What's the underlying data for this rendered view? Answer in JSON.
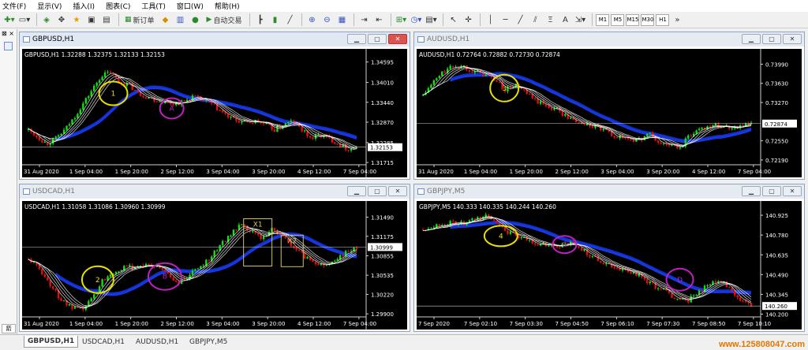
{
  "menu": [
    "文件(F)",
    "显示(V)",
    "插入(I)",
    "图表(C)",
    "工具(T)",
    "窗口(W)",
    "帮助(H)"
  ],
  "toolbar": {
    "new_order": "新订单",
    "auto_trading": "自动交易",
    "timeframes": [
      "M1",
      "M5",
      "M15",
      "M30",
      "H1"
    ]
  },
  "windows": [
    {
      "title": "GBPUSD,H1",
      "symbol_line": "GBPUSD,H1  1.32288 1.32375 1.32133 1.32153",
      "prices": [
        "1.34595",
        "1.34010",
        "1.33440",
        "1.32870",
        "1.32285",
        "1.32153",
        "1.31715"
      ],
      "current": "1.32153",
      "dates": [
        "31 Aug 2020",
        "1 Sep 04:00",
        "1 Sep 20:00",
        "2 Sep 12:00",
        "3 Sep 04:00",
        "3 Sep 20:00",
        "4 Sep 12:00",
        "7 Sep 04:00"
      ],
      "marks": [
        {
          "label": "1",
          "color": "#e8e000"
        },
        {
          "label": "A",
          "color": "#c020c0"
        }
      ],
      "series": [
        1.3265,
        1.3245,
        1.3225,
        1.324,
        1.3265,
        1.33,
        1.334,
        1.338,
        1.342,
        1.343,
        1.34,
        1.3395,
        1.337,
        1.336,
        1.335,
        1.3345,
        1.334,
        1.3345,
        1.336,
        1.335,
        1.334,
        1.332,
        1.33,
        1.329,
        1.3285,
        1.329,
        1.328,
        1.3265,
        1.328,
        1.329,
        1.3265,
        1.324,
        1.325,
        1.324,
        1.3225,
        1.321,
        1.3215
      ],
      "ylim": [
        1.3165,
        1.347
      ]
    },
    {
      "title": "AUDUSD,H1",
      "symbol_line": "AUDUSD,H1  0.72764 0.72882 0.72730 0.72874",
      "prices": [
        "0.73990",
        "0.73630",
        "0.73270",
        "0.72874",
        "0.72550",
        "0.72190"
      ],
      "current": "0.72874",
      "dates": [
        "31 Aug 2020",
        "1 Sep 04:00",
        "1 Sep 20:00",
        "2 Sep 12:00",
        "3 Sep 04:00",
        "3 Sep 20:00",
        "4 Sep 12:00",
        "7 Sep 04:00"
      ],
      "marks": [
        {
          "label": "3",
          "color": "#e8e000"
        }
      ],
      "series": [
        0.734,
        0.7365,
        0.7385,
        0.7395,
        0.7395,
        0.7385,
        0.738,
        0.737,
        0.735,
        0.736,
        0.7345,
        0.733,
        0.732,
        0.7315,
        0.73,
        0.729,
        0.7285,
        0.728,
        0.727,
        0.7262,
        0.726,
        0.7255,
        0.727,
        0.725,
        0.7248,
        0.724,
        0.7265,
        0.7278,
        0.7285,
        0.7284,
        0.728,
        0.7284,
        0.7287
      ],
      "ylim": [
        0.721,
        0.741
      ]
    },
    {
      "title": "USDCAD,H1",
      "symbol_line": "USDCAD,H1  1.31058 1.31086 1.30960 1.30999",
      "prices": [
        "1.31490",
        "1.31175",
        "1.30999",
        "1.30855",
        "1.30535",
        "1.30220",
        "1.29900"
      ],
      "current": "1.30999",
      "dates": [
        "31 Aug 2020",
        "1 Sep 04:00",
        "1 Sep 20:00",
        "2 Sep 12:00",
        "3 Sep 04:00",
        "3 Sep 20:00",
        "4 Sep 12:00",
        "7 Sep 04:00"
      ],
      "marks": [
        {
          "label": "2",
          "color": "#e8e000"
        },
        {
          "label": "B",
          "color": "#c020c0"
        },
        {
          "label": "X1",
          "color": "#d8c060"
        },
        {
          "label": "X2",
          "color": "#d8c060"
        }
      ],
      "series": [
        1.308,
        1.3065,
        1.304,
        1.3015,
        1.3,
        1.2995,
        1.3015,
        1.3045,
        1.306,
        1.3065,
        1.3068,
        1.307,
        1.3068,
        1.306,
        1.304,
        1.305,
        1.3065,
        1.308,
        1.31,
        1.312,
        1.3135,
        1.3125,
        1.3115,
        1.313,
        1.3118,
        1.31,
        1.3085,
        1.3075,
        1.307,
        1.308,
        1.309,
        1.31
      ],
      "ylim": [
        1.2985,
        1.316
      ]
    },
    {
      "title": "GBPJPY,M5",
      "symbol_line": "GBPJPY,M5  140.333 140.335 140.244 140.260",
      "prices": [
        "140.925",
        "140.780",
        "140.635",
        "140.490",
        "140.345",
        "140.260",
        "140.200"
      ],
      "current": "140.260",
      "dates": [
        "7 Sep 2020",
        "7 Sep 02:10",
        "7 Sep 03:30",
        "7 Sep 04:50",
        "7 Sep 06:10",
        "7 Sep 07:30",
        "7 Sep 08:50",
        "7 Sep 10:10"
      ],
      "marks": [
        {
          "label": "4",
          "color": "#e8e000"
        },
        {
          "label": "C",
          "color": "#c020c0"
        },
        {
          "label": "D",
          "color": "#c020c0"
        }
      ],
      "series": [
        140.82,
        140.85,
        140.86,
        140.87,
        140.86,
        140.9,
        140.92,
        140.88,
        140.8,
        140.76,
        140.74,
        140.71,
        140.7,
        140.7,
        140.72,
        140.68,
        140.62,
        140.58,
        140.55,
        140.52,
        140.5,
        140.45,
        140.4,
        140.36,
        140.31,
        140.3,
        140.36,
        140.42,
        140.44,
        140.4,
        140.3,
        140.26
      ],
      "ylim": [
        140.18,
        140.96
      ]
    }
  ],
  "status_tabs": [
    "GBPUSD,H1",
    "USDCAD,H1",
    "AUDUSD,H1",
    "GBPJPY,M5"
  ],
  "watermark": "www.125808047.com"
}
